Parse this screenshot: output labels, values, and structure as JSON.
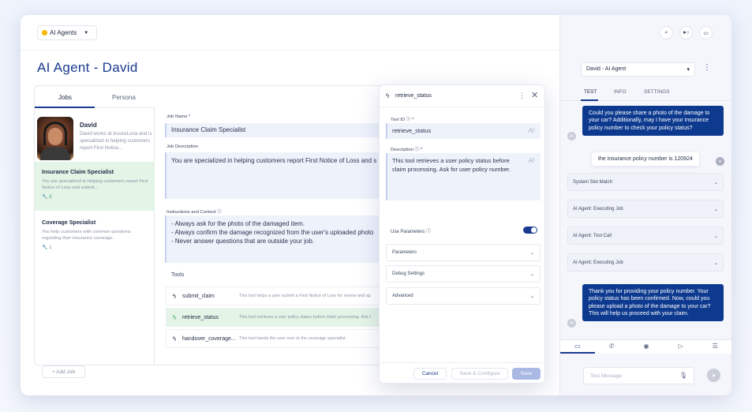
{
  "topbar": {
    "agent_select": "AI Agents"
  },
  "page": {
    "title": "AI Agent - David"
  },
  "tabs": [
    "Jobs",
    "Persona"
  ],
  "profile": {
    "name": "David",
    "description": "David works at InsureLuna and is specialized in helping customers report First Notice..."
  },
  "jobs": [
    {
      "title": "Insurance Claim Specialist",
      "description": "You are specialized in helping customers report First Notice of Loss and submit...",
      "tools": "3",
      "selected": true
    },
    {
      "title": "Coverage Specialist",
      "description": "You help customers with common questions regarding their insurance coverage.",
      "tools": "1",
      "selected": false
    }
  ],
  "add_job": "+ Add Job",
  "detail": {
    "job_name_label": "Job Name *",
    "job_name": "Insurance Claim Specialist",
    "job_desc_label": "Job Description",
    "job_desc": "You are specialized in helping customers report First Notice of Loss and s",
    "instructions_label": "Instructions and Context",
    "instructions": [
      "- Always ask for the photo of the damaged item.",
      "- Always confirm the damage recognized from the user's uploaded photo",
      "- Never answer questions that are outside your job."
    ],
    "tools_label": "Tools",
    "tools": [
      {
        "name": "submit_claim",
        "desc": "This tool helps a user submit a First Notice of Loss for review and ap"
      },
      {
        "name": "retrieve_status",
        "desc": "This tool retrieves a user policy status before claim processing. Ask f"
      },
      {
        "name": "handover_coverage...",
        "desc": "This tool hands the user over to the coverage specialist."
      }
    ]
  },
  "tool_panel": {
    "title": "retrieve_status",
    "tool_id_label": "Tool ID",
    "tool_id": "retrieve_status",
    "desc_label": "Description",
    "description": "This tool retrieves a user policy status before claim processing. Ask for user policy number.",
    "ai_tag": "AI",
    "use_params_label": "Use Parameters",
    "accordions": [
      "Parameters",
      "Debug Settings",
      "Advanced"
    ],
    "cancel": "Cancel",
    "save_configure": "Save & Configure",
    "save": "Save"
  },
  "chat": {
    "agent_dropdown": "David - AI Agent",
    "tabs": [
      "TEST",
      "INFO",
      "SETTINGS"
    ],
    "bot_msg_1": "Could you please share a photo of the damage to your car? Additionally, may I have your insurance policy number to check your policy status?",
    "user_msg": "the insurance policy number is 120924",
    "status_cards": [
      "System Slot Match",
      "AI Agent: Executing Job",
      "AI Agent: Tool Call",
      "AI Agent: Executing Job"
    ],
    "bot_msg_2": "Thank you for providing your policy number. Your policy status has been confirmed. Now, could you please upload a photo of the damage to your car? This will help us proceed with your claim.",
    "bot_avatar": "AI",
    "input_placeholder": "Text Message"
  }
}
